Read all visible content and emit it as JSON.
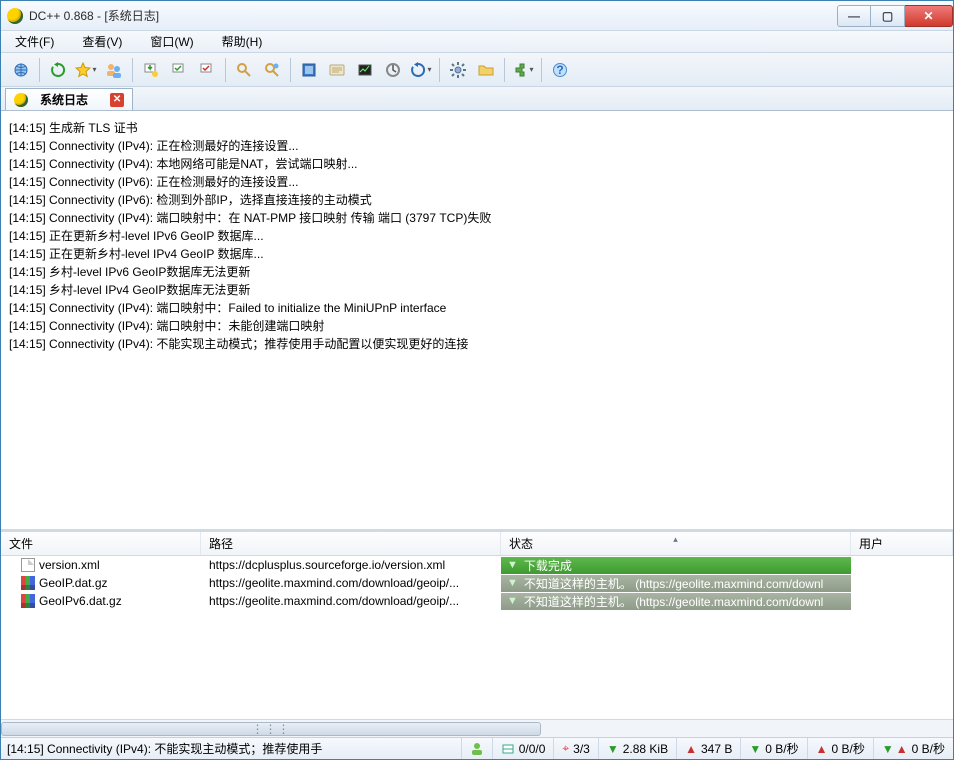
{
  "window": {
    "title": "DC++ 0.868 - [系统日志]"
  },
  "menu": {
    "file": "文件(F)",
    "view": "查看(V)",
    "window": "窗口(W)",
    "help": "帮助(H)"
  },
  "tab": {
    "label": "系统日志"
  },
  "log_lines": [
    "[14:15] 生成新 TLS 证书",
    "[14:15] Connectivity (IPv4): 正在检测最好的连接设置...",
    "[14:15] Connectivity (IPv4): 本地网络可能是NAT，尝试端口映射...",
    "[14:15] Connectivity (IPv6): 正在检测最好的连接设置...",
    "[14:15] Connectivity (IPv6): 检测到外部IP，选择直接连接的主动模式",
    "[14:15] Connectivity (IPv4): 端口映射中：在 NAT-PMP 接口映射 传输 端口 (3797 TCP)失败",
    "[14:15] 正在更新乡村-level IPv6 GeoIP 数据库...",
    "[14:15] 正在更新乡村-level IPv4 GeoIP 数据库...",
    "[14:15] 乡村-level IPv6 GeoIP数据库无法更新",
    "[14:15] 乡村-level IPv4 GeoIP数据库无法更新",
    "[14:15] Connectivity (IPv4): 端口映射中：Failed to initialize the MiniUPnP interface",
    "[14:15] Connectivity (IPv4): 端口映射中：未能创建端口映射",
    "[14:15] Connectivity (IPv4): 不能实现主动模式；推荐使用手动配置以便实现更好的连接"
  ],
  "dl_head": {
    "file": "文件",
    "path": "路径",
    "status": "状态",
    "user": "用户"
  },
  "downloads": [
    {
      "file": "version.xml",
      "icon": "file",
      "path": "https://dcplusplus.sourceforge.io/version.xml",
      "status": "下载完成",
      "status_class": "status-ok"
    },
    {
      "file": "GeoIP.dat.gz",
      "icon": "geo",
      "path": "https://geolite.maxmind.com/download/geoip/...",
      "status": "不知道这样的主机。  (https://geolite.maxmind.com/downl",
      "status_class": "status-err"
    },
    {
      "file": "GeoIPv6.dat.gz",
      "icon": "geo",
      "path": "https://geolite.maxmind.com/download/geoip/...",
      "status": "不知道这样的主机。  (https://geolite.maxmind.com/downl",
      "status_class": "status-err"
    }
  ],
  "status": {
    "msg": "[14:15] Connectivity (IPv4): 不能实现主动模式；推荐使用手",
    "slots": "0/0/0",
    "hubs": "3/3",
    "down_total": "2.88 KiB",
    "up_total": "347 B",
    "down_rate": "0 B/秒",
    "up_rate": "0 B/秒",
    "net_rate": "0 B/秒"
  }
}
